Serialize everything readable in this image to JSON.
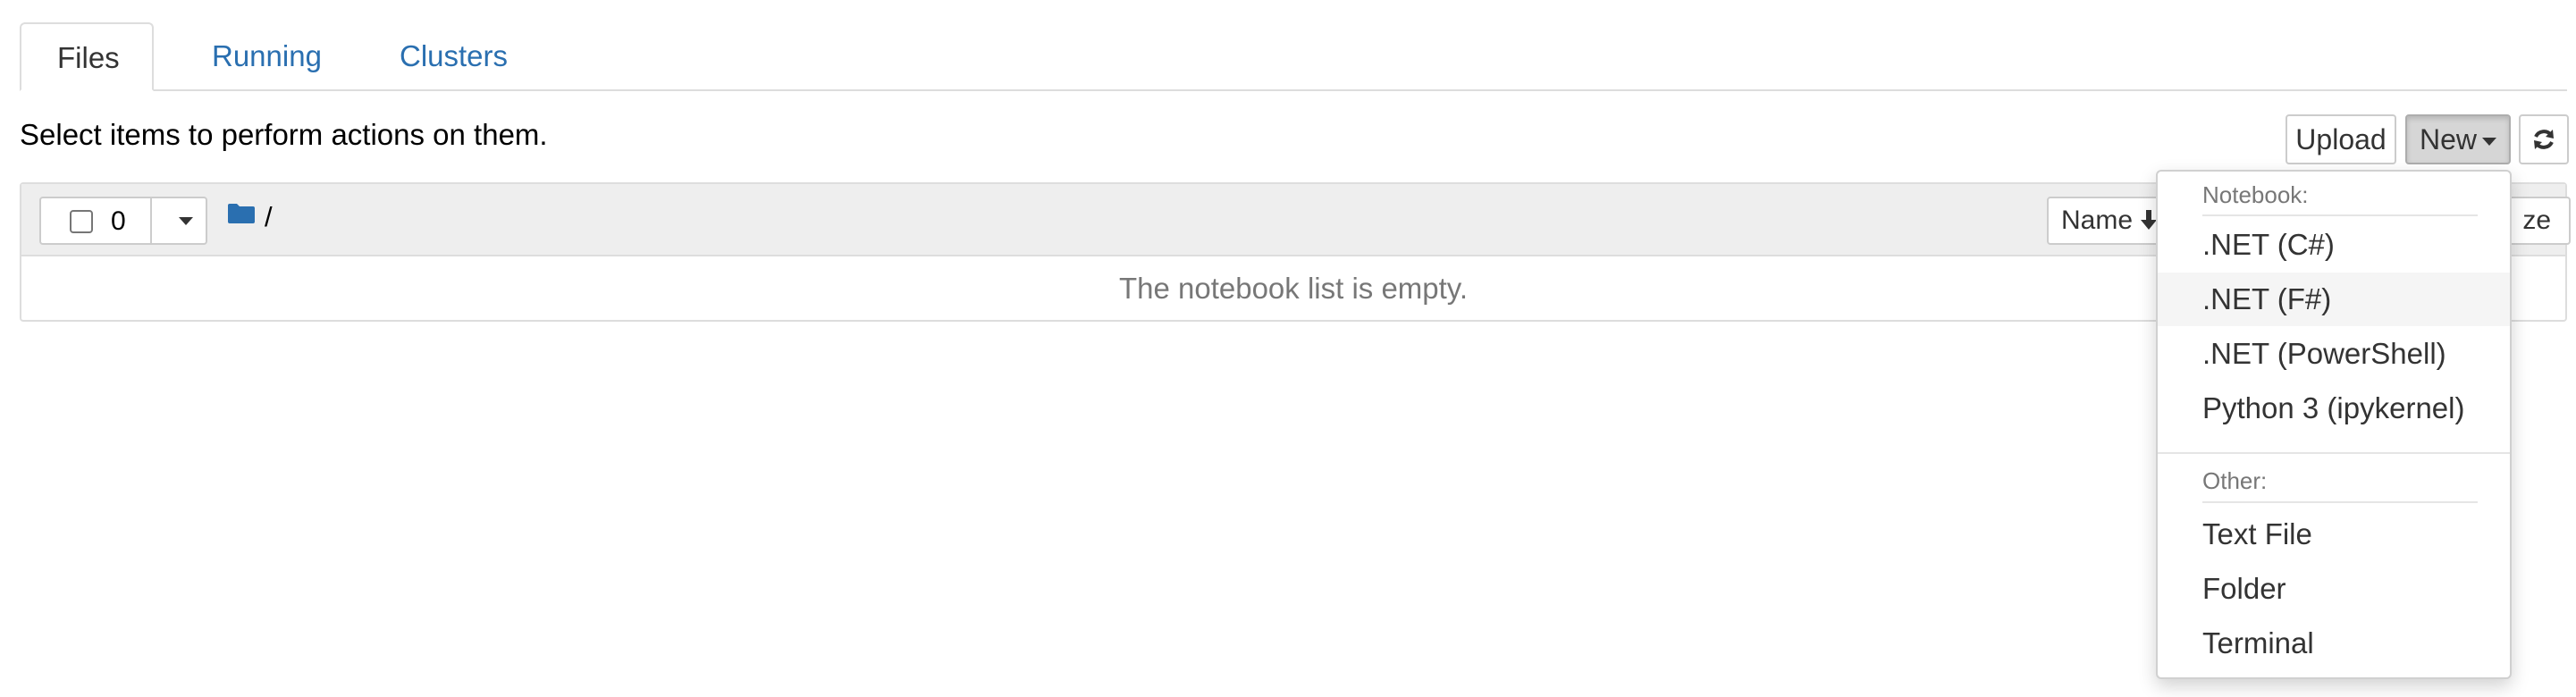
{
  "tabs": [
    {
      "label": "Files",
      "active": true
    },
    {
      "label": "Running",
      "active": false
    },
    {
      "label": "Clusters",
      "active": false
    }
  ],
  "instructions": "Select items to perform actions on them.",
  "toolbar": {
    "upload_label": "Upload",
    "new_label": "New",
    "refresh_icon": "refresh-icon"
  },
  "file_list": {
    "selected_count": "0",
    "breadcrumb": "/",
    "sort_name_label": "Name",
    "sort_name_icon": "arrow-down-icon",
    "sort_size_label": "ze",
    "empty_message": "The notebook list is empty."
  },
  "new_menu": {
    "notebook_header": "Notebook:",
    "notebook_items": [
      ".NET (C#)",
      ".NET (F#)",
      ".NET (PowerShell)",
      "Python 3 (ipykernel)"
    ],
    "other_header": "Other:",
    "other_items": [
      "Text File",
      "Folder",
      "Terminal"
    ],
    "hovered_item": ".NET (F#)"
  },
  "colors": {
    "link": "#2a6fb0",
    "folder_icon": "#2a6fb0",
    "header_bg": "#eeeeee",
    "muted_text": "#777777"
  }
}
